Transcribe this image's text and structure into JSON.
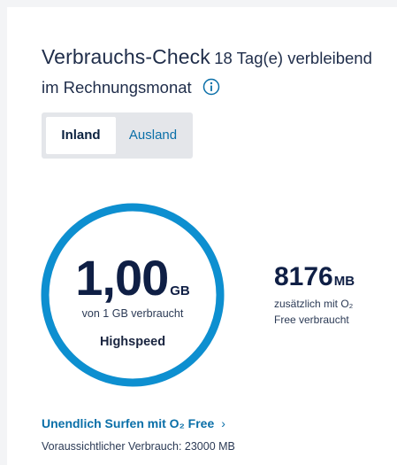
{
  "usage_check": {
    "title": "Verbrauchs-Check",
    "days_remaining_text": "18 Tag(e) verbleibend",
    "period_text": "im Rechnungsmonat"
  },
  "tabs": {
    "domestic_label": "Inland",
    "abroad_label": "Ausland",
    "selected": "Inland"
  },
  "meter": {
    "value": "1,00",
    "unit": "GB",
    "used_text": "von 1 GB verbraucht",
    "speed_text": "Highspeed",
    "used_fraction": 1.0,
    "ring_color": "#0d8fd0"
  },
  "additional": {
    "value": "8176",
    "unit": "MB",
    "desc_line1": "zusätzlich mit O₂",
    "desc_line2": "Free verbraucht"
  },
  "unlimited_link": {
    "label": "Unendlich Surfen mit O₂ Free"
  },
  "forecast_text": "Voraussichtlicher Verbrauch: 23000 MB",
  "colors": {
    "primary_text": "#1f2d4a",
    "link": "#0a6fa8",
    "ring": "#0d8fd0",
    "segment_bg": "#e4e6ea"
  }
}
